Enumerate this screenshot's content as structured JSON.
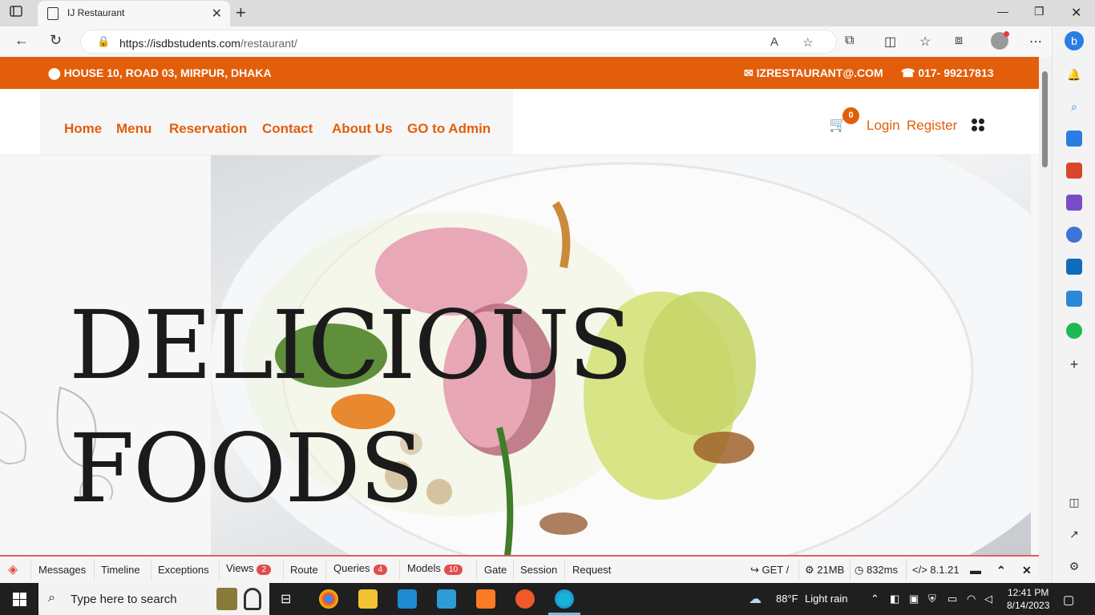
{
  "browser": {
    "tab_title": "IJ Restaurant",
    "url_host": "https://isdbstudents.com",
    "url_path": "/restaurant/"
  },
  "topbar": {
    "address": "HOUSE 10, ROAD 03, MIRPUR, DHAKA",
    "email": "IZRESTAURANT@.COM",
    "phone": "017- 99217813"
  },
  "nav": {
    "items": [
      "Home",
      "Menu",
      "Reservation",
      "Contact",
      "About Us",
      "GO to Admin"
    ],
    "cart_count": "0",
    "login": "Login",
    "register": "Register"
  },
  "hero": {
    "line1": "DELICIOUS",
    "line2": "FOODS"
  },
  "debugbar": {
    "items": [
      {
        "label": "Messages"
      },
      {
        "label": "Timeline"
      },
      {
        "label": "Exceptions"
      },
      {
        "label": "Views",
        "badge": "2"
      },
      {
        "label": "Route"
      },
      {
        "label": "Queries",
        "badge": "4"
      },
      {
        "label": "Models",
        "badge": "10"
      },
      {
        "label": "Gate"
      },
      {
        "label": "Session"
      },
      {
        "label": "Request"
      }
    ],
    "method": "GET /",
    "memory": "21MB",
    "time": "832ms",
    "php": "8.1.21"
  },
  "taskbar": {
    "search_placeholder": "Type here to search",
    "weather_temp": "88°F",
    "weather_desc": "Light rain",
    "time": "12:41 PM",
    "date": "8/14/2023"
  },
  "colors": {
    "brand": "#e25e0a",
    "debug_badge": "#e34c4c"
  }
}
